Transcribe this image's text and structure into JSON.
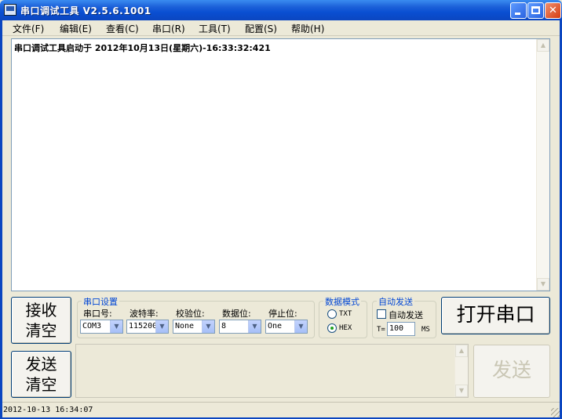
{
  "window": {
    "title": "串口调试工具  V2.5.6.1001",
    "minimize_glyph": "",
    "close_glyph": "✕"
  },
  "menu": [
    {
      "label": "文件(F)"
    },
    {
      "label": "编辑(E)"
    },
    {
      "label": "查看(C)"
    },
    {
      "label": "串口(R)"
    },
    {
      "label": "工具(T)"
    },
    {
      "label": "配置(S)"
    },
    {
      "label": "帮助(H)"
    }
  ],
  "receive": {
    "text": "串口调试工具启动于 2012年10月13日(星期六)-16:33:32:421"
  },
  "buttons": {
    "recv_clear_line1": "接收",
    "recv_clear_line2": "清空",
    "send_clear_line1": "发送",
    "send_clear_line2": "清空",
    "open_port": "打开串口",
    "send": "发送"
  },
  "serial_settings": {
    "group_label": "串口设置",
    "port_label": "串口号:",
    "port_value": "COM3",
    "baud_label": "波特率:",
    "baud_value": "115200",
    "parity_label": "校验位:",
    "parity_value": "None",
    "databits_label": "数据位:",
    "databits_value": "8",
    "stopbits_label": "停止位:",
    "stopbits_value": "One"
  },
  "data_mode": {
    "group_label": "数据模式",
    "txt_label": "TXT",
    "hex_label": "HEX",
    "selected": "HEX"
  },
  "auto_send": {
    "group_label": "自动发送",
    "checkbox_label": "自动发送",
    "checked": false,
    "period_prefix": "T=",
    "period_value": "100",
    "period_unit": "MS"
  },
  "status": {
    "datetime": "2012-10-13 16:34:07"
  },
  "icons": {
    "combo_arrow": "▼",
    "scroll_up": "▲",
    "scroll_down": "▼"
  },
  "colors": {
    "titlebar": "#0b46c0",
    "group_label": "#0046d5",
    "window_bg": "#ece9d8"
  }
}
